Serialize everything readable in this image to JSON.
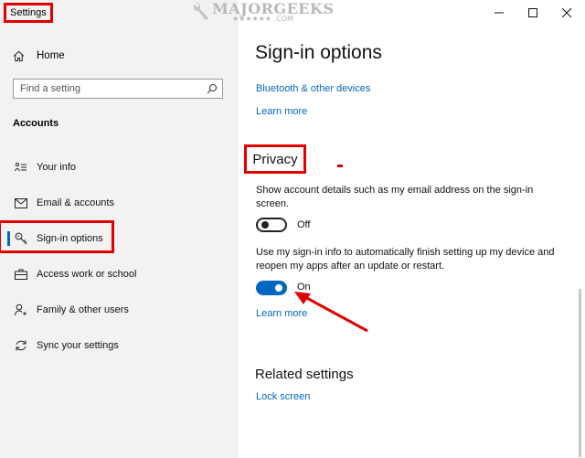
{
  "window": {
    "title": "Settings",
    "controls": {
      "minimize": "minimize-icon",
      "maximize": "maximize-icon",
      "close": "close-icon"
    }
  },
  "watermark": {
    "brand": "MAJORGEEKS",
    "suffix": "★★★★★★ .COM"
  },
  "sidebar": {
    "home_label": "Home",
    "search_placeholder": "Find a setting",
    "section_title": "Accounts",
    "items": [
      {
        "label": "Your info",
        "icon": "person-card-icon"
      },
      {
        "label": "Email & accounts",
        "icon": "mail-icon"
      },
      {
        "label": "Sign-in options",
        "icon": "key-icon",
        "active": true
      },
      {
        "label": "Access work or school",
        "icon": "briefcase-icon"
      },
      {
        "label": "Family & other users",
        "icon": "person-add-icon"
      },
      {
        "label": "Sync your settings",
        "icon": "sync-icon"
      }
    ]
  },
  "main": {
    "title": "Sign-in options",
    "bluetooth_link": "Bluetooth & other devices",
    "learn_more_1": "Learn more",
    "privacy": {
      "heading": "Privacy",
      "setting1_text": "Show account details such as my email address on the sign-in screen.",
      "setting1_state": "Off",
      "setting2_text": "Use my sign-in info to automatically finish setting up my device and reopen my apps after an update or restart.",
      "setting2_state": "On",
      "learn_more": "Learn more"
    },
    "related": {
      "heading": "Related settings",
      "lock_screen_link": "Lock screen"
    }
  },
  "colors": {
    "accent": "#0067c0",
    "highlight": "#e00000",
    "sidebar_bg": "#f2f2f2"
  }
}
